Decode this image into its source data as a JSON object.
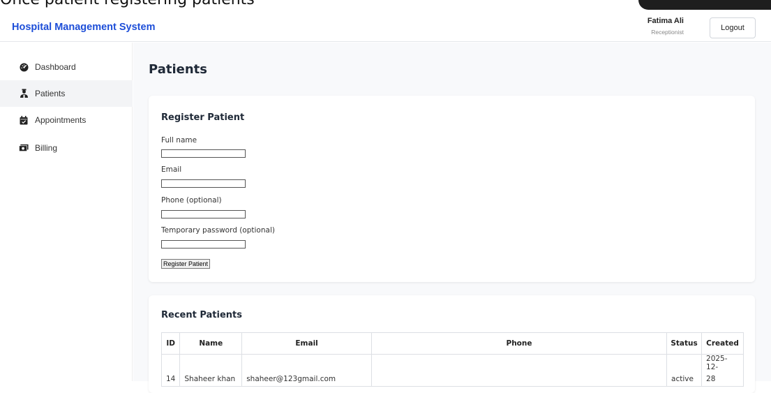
{
  "caption": {
    "text": "Once patient registering patients"
  },
  "header": {
    "brand": "Hospital Management System",
    "user_name": "Fatima Ali",
    "user_role": "Receptionist",
    "logout_label": "Logout"
  },
  "sidebar": {
    "items": [
      {
        "label": "Dashboard",
        "icon": "dashboard-gauge-icon"
      },
      {
        "label": "Patients",
        "icon": "patients-icon"
      },
      {
        "label": "Appointments",
        "icon": "calendar-icon"
      },
      {
        "label": "Billing",
        "icon": "money-icon"
      }
    ],
    "active_index": 1
  },
  "page": {
    "title": "Patients"
  },
  "register_form": {
    "title": "Register Patient",
    "fields": [
      {
        "label": "Full name",
        "value": ""
      },
      {
        "label": "Email",
        "value": ""
      },
      {
        "label": "Phone (optional)",
        "value": ""
      },
      {
        "label": "Temporary password (optional)",
        "value": ""
      }
    ],
    "submit_label": "Register Patient"
  },
  "recent_patients": {
    "title": "Recent Patients",
    "columns": [
      "ID",
      "Name",
      "Email",
      "Phone",
      "Status",
      "Created"
    ],
    "rows": [
      {
        "id": "14",
        "name": "Shaheer khan",
        "email": "shaheer@123gmail.com",
        "phone": "",
        "status": "active",
        "created_line1": "2025-12-",
        "created_line2": "28"
      }
    ]
  },
  "colors": {
    "brand": "#1d4ed8",
    "page_background": "#f8f9fb",
    "active_nav": "#f3f4f6"
  }
}
